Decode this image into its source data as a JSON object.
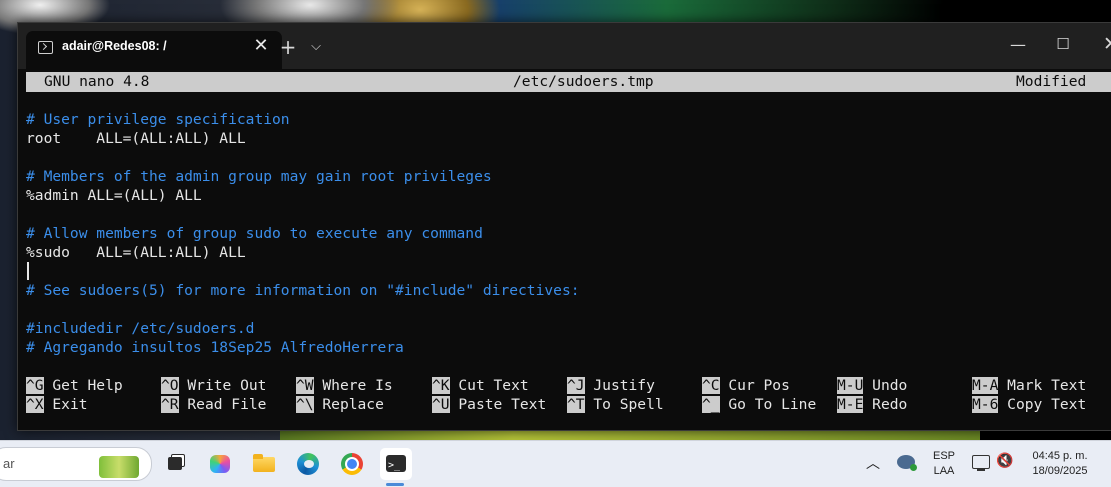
{
  "window": {
    "tab_title": "adair@Redes08: /",
    "tab_close": "✕",
    "new_tab": "+",
    "tab_menu": "⌵",
    "minimize": "—",
    "maximize": "☐",
    "close": "✕"
  },
  "nano": {
    "version": "GNU nano 4.8",
    "filename": "/etc/sudoers.tmp",
    "status": "Modified",
    "lines": [
      {
        "type": "comment",
        "text": "# User privilege specification"
      },
      {
        "type": "text",
        "text": "root    ALL=(ALL:ALL) ALL"
      },
      {
        "type": "blank",
        "text": ""
      },
      {
        "type": "comment",
        "text": "# Members of the admin group may gain root privileges"
      },
      {
        "type": "text",
        "text": "%admin ALL=(ALL) ALL"
      },
      {
        "type": "blank",
        "text": ""
      },
      {
        "type": "comment",
        "text": "# Allow members of group sudo to execute any command"
      },
      {
        "type": "text",
        "text": "%sudo   ALL=(ALL:ALL) ALL"
      },
      {
        "type": "blank",
        "text": ""
      },
      {
        "type": "comment",
        "text": "# See sudoers(5) for more information on \"#include\" directives:"
      },
      {
        "type": "blank",
        "text": ""
      },
      {
        "type": "comment",
        "text": "#includedir /etc/sudoers.d"
      },
      {
        "type": "comment",
        "text": "# Agregando insultos 18Sep25 AlfredoHerrera"
      }
    ],
    "shortcuts_row1": [
      {
        "key": "^G",
        "label": "Get Help"
      },
      {
        "key": "^O",
        "label": "Write Out"
      },
      {
        "key": "^W",
        "label": "Where Is"
      },
      {
        "key": "^K",
        "label": "Cut Text"
      },
      {
        "key": "^J",
        "label": "Justify"
      },
      {
        "key": "^C",
        "label": "Cur Pos"
      },
      {
        "key": "M-U",
        "label": "Undo"
      },
      {
        "key": "M-A",
        "label": "Mark Text"
      }
    ],
    "shortcuts_row2": [
      {
        "key": "^X",
        "label": "Exit"
      },
      {
        "key": "^R",
        "label": "Read File"
      },
      {
        "key": "^\\",
        "label": "Replace"
      },
      {
        "key": "^U",
        "label": "Paste Text"
      },
      {
        "key": "^T",
        "label": "To Spell"
      },
      {
        "key": "^_",
        "label": "Go To Line"
      },
      {
        "key": "M-E",
        "label": "Redo"
      },
      {
        "key": "M-6",
        "label": "Copy Text"
      }
    ]
  },
  "taskbar": {
    "search_text": "ar",
    "tray_chevron": "︿",
    "lang_line1": "ESP",
    "lang_line2": "LAA",
    "volume": "🔇",
    "time": "04:45 p. m.",
    "date": "18/09/2025"
  },
  "colors": {
    "comment": "#3b8eea",
    "text": "#e6e6e6",
    "bar": "#cccccc",
    "background": "#0c0c0c"
  }
}
